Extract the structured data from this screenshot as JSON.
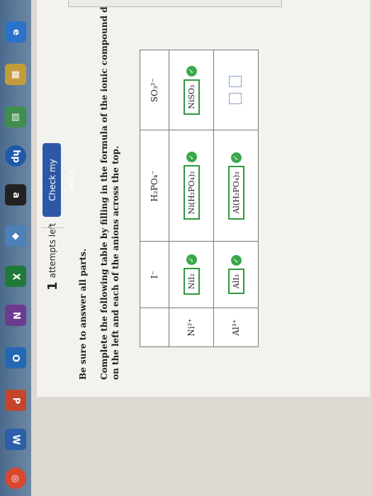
{
  "header": {
    "attempts_count": "1",
    "attempts_label": "attempts left",
    "check_button": "Check my work"
  },
  "instructions": {
    "line0": "Be sure to answer all parts.",
    "line1": "Complete the following table by filling in the formula of the ionic compound derived from the cation",
    "line2": "on the left and each of the anions across the top."
  },
  "table": {
    "anions": [
      "I⁻",
      "H₂PO₄⁻",
      "SO₃²⁻"
    ],
    "rows": [
      {
        "cation": "Ni²⁺",
        "cells": [
          "NiI₂",
          "Ni(H₂PO₄)₂",
          "NiSO₃"
        ]
      },
      {
        "cation": "Al³⁺",
        "cells": [
          "AlI₃",
          "Al(H₂PO₄)₃",
          ""
        ]
      }
    ]
  },
  "side": {
    "partial_label": "gree"
  }
}
